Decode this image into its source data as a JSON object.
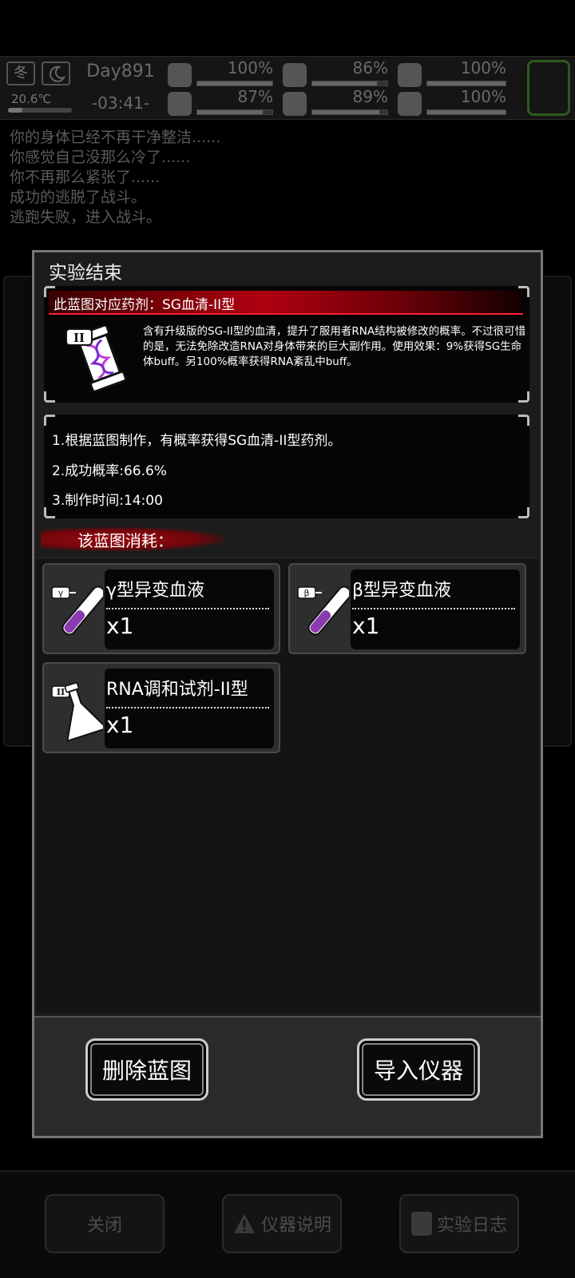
{
  "hud": {
    "season": "冬",
    "temperature": "20.6℃",
    "day": "Day891",
    "time": "-03:41-",
    "stats": [
      {
        "icon": "medkit-icon",
        "value": "100%",
        "level": 1.0
      },
      {
        "icon": "stomach-icon",
        "value": "86%",
        "level": 0.86
      },
      {
        "icon": "bladder-icon",
        "value": "100%",
        "level": 1.0
      },
      {
        "icon": "boot-icon",
        "value": "87%",
        "level": 0.87
      },
      {
        "icon": "water-drop-icon",
        "value": "89%",
        "level": 0.89
      },
      {
        "icon": "heart-icon",
        "value": "100%",
        "level": 1.0
      }
    ]
  },
  "log": [
    "你的身体已经不再干净整洁......",
    "你感觉自己没那么冷了......",
    "你不再那么紧张了......",
    "成功的逃脱了战斗。",
    "逃跑失败，进入战斗。"
  ],
  "dialog": {
    "title": "实验结束",
    "blueprint_header": "此蓝图对应药剂：SG血清-II型",
    "blueprint_desc": "含有升级版的SG-II型的血清，提升了服用者RNA结构被修改的概率。不过很可惜的是，无法免除改造RNA对身体带来的巨大副作用。使用效果：9%获得SG生命体buff。另100%概率获得RNA紊乱中buff。",
    "info": [
      "1.根据蓝图制作，有概率获得SG血清-II型药剂。",
      "2.成功概率:66.6%",
      "3.制作时间:14:00"
    ],
    "consume_title": "该蓝图消耗：",
    "items": [
      {
        "name": "γ型异变血液",
        "qty": "x1",
        "tag": "γ",
        "icon": "test-tube-icon"
      },
      {
        "name": "β型异变血液",
        "qty": "x1",
        "tag": "β",
        "icon": "test-tube-icon"
      },
      {
        "name": "RNA调和试剂-II型",
        "qty": "x1",
        "tag": "II",
        "icon": "flask-icon"
      }
    ],
    "delete_label": "删除蓝图",
    "import_label": "导入仪器"
  },
  "bottom": {
    "close_label": "关闭",
    "instrument_label": "仪器说明",
    "log_label": "实验日志"
  }
}
